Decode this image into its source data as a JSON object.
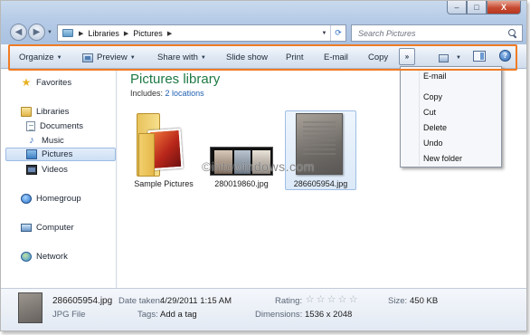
{
  "window": {
    "buttons": {
      "minimize": "–",
      "maximize": "□",
      "close": "X"
    }
  },
  "address": {
    "crumbs": [
      "Libraries",
      "Pictures"
    ],
    "separator": "▶"
  },
  "search": {
    "placeholder": "Search Pictures"
  },
  "toolbar": {
    "organize": "Organize",
    "preview": "Preview",
    "share_with": "Share with",
    "slide_show": "Slide show",
    "print": "Print",
    "email": "E-mail",
    "copy": "Copy",
    "more": "»"
  },
  "sidebar": {
    "favorites": "Favorites",
    "libraries": "Libraries",
    "documents": "Documents",
    "music": "Music",
    "pictures": "Pictures",
    "videos": "Videos",
    "homegroup": "Homegroup",
    "computer": "Computer",
    "network": "Network"
  },
  "library": {
    "title": "Pictures library",
    "includes_label": "Includes:",
    "includes_link": "2 locations"
  },
  "items": [
    {
      "name": "Sample Pictures"
    },
    {
      "name": "280019860.jpg"
    },
    {
      "name": "286605954.jpg"
    }
  ],
  "watermark": "©intowindows.com",
  "menu": {
    "items": [
      "E-mail",
      "Copy",
      "Cut",
      "Delete",
      "Undo",
      "New folder"
    ]
  },
  "details": {
    "filename": "286605954.jpg",
    "filetype": "JPG File",
    "date_label": "Date taken:",
    "date_value": "4/29/2011 1:15 AM",
    "tags_label": "Tags:",
    "tags_value": "Add a tag",
    "rating_label": "Rating:",
    "rating_value": 0,
    "dimensions_label": "Dimensions:",
    "dimensions_value": "1536 x 2048",
    "size_label": "Size:",
    "size_value": "450 KB"
  },
  "colors": {
    "highlight_box": "#f07c24",
    "library_title": "#1e7a45",
    "link": "#1f5fb1"
  }
}
